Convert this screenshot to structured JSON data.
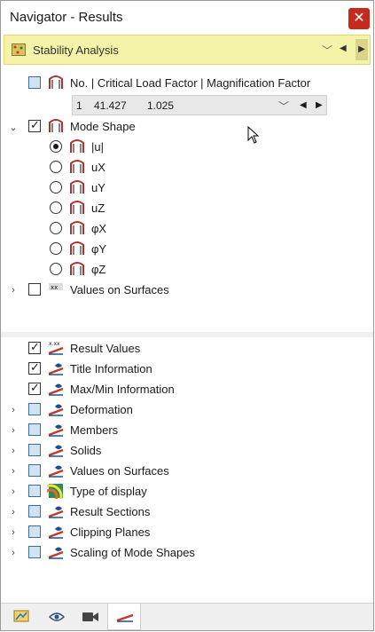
{
  "window": {
    "title": "Navigator - Results",
    "close_glyph": "✕"
  },
  "combo": {
    "label": "Stability Analysis",
    "icon": "stability-analysis-icon"
  },
  "top_tree": {
    "no_row_label": "No. | Critical Load Factor | Magnification Factor",
    "mode_values": {
      "no": "1",
      "critical_load_factor": "41.427",
      "magnification_factor": "1.025"
    },
    "mode_shape_label": "Mode Shape",
    "mode_options": [
      {
        "label": "|u|",
        "selected": true
      },
      {
        "label": "uX",
        "selected": false
      },
      {
        "label": "uY",
        "selected": false
      },
      {
        "label": "uZ",
        "selected": false
      },
      {
        "label": "φX",
        "selected": false
      },
      {
        "label": "φY",
        "selected": false
      },
      {
        "label": "φZ",
        "selected": false
      }
    ],
    "values_on_surfaces_label": "Values on Surfaces"
  },
  "bottom_tree": {
    "items": [
      {
        "label": "Result Values",
        "checked": true,
        "expandable": false
      },
      {
        "label": "Title Information",
        "checked": true,
        "expandable": false
      },
      {
        "label": "Max/Min Information",
        "checked": true,
        "expandable": false
      },
      {
        "label": "Deformation",
        "checked": false,
        "expandable": true
      },
      {
        "label": "Members",
        "checked": false,
        "expandable": true
      },
      {
        "label": "Solids",
        "checked": false,
        "expandable": true
      },
      {
        "label": "Values on Surfaces",
        "checked": false,
        "expandable": true
      },
      {
        "label": "Type of display",
        "checked": false,
        "expandable": true
      },
      {
        "label": "Result Sections",
        "checked": false,
        "expandable": true
      },
      {
        "label": "Clipping Planes",
        "checked": false,
        "expandable": true
      },
      {
        "label": "Scaling of Mode Shapes",
        "checked": false,
        "expandable": true
      }
    ]
  },
  "colors": {
    "combo_bg": "#f5f3a8",
    "close_bg": "#c42b1c",
    "checkbox_blue": "#cfe3f3"
  }
}
